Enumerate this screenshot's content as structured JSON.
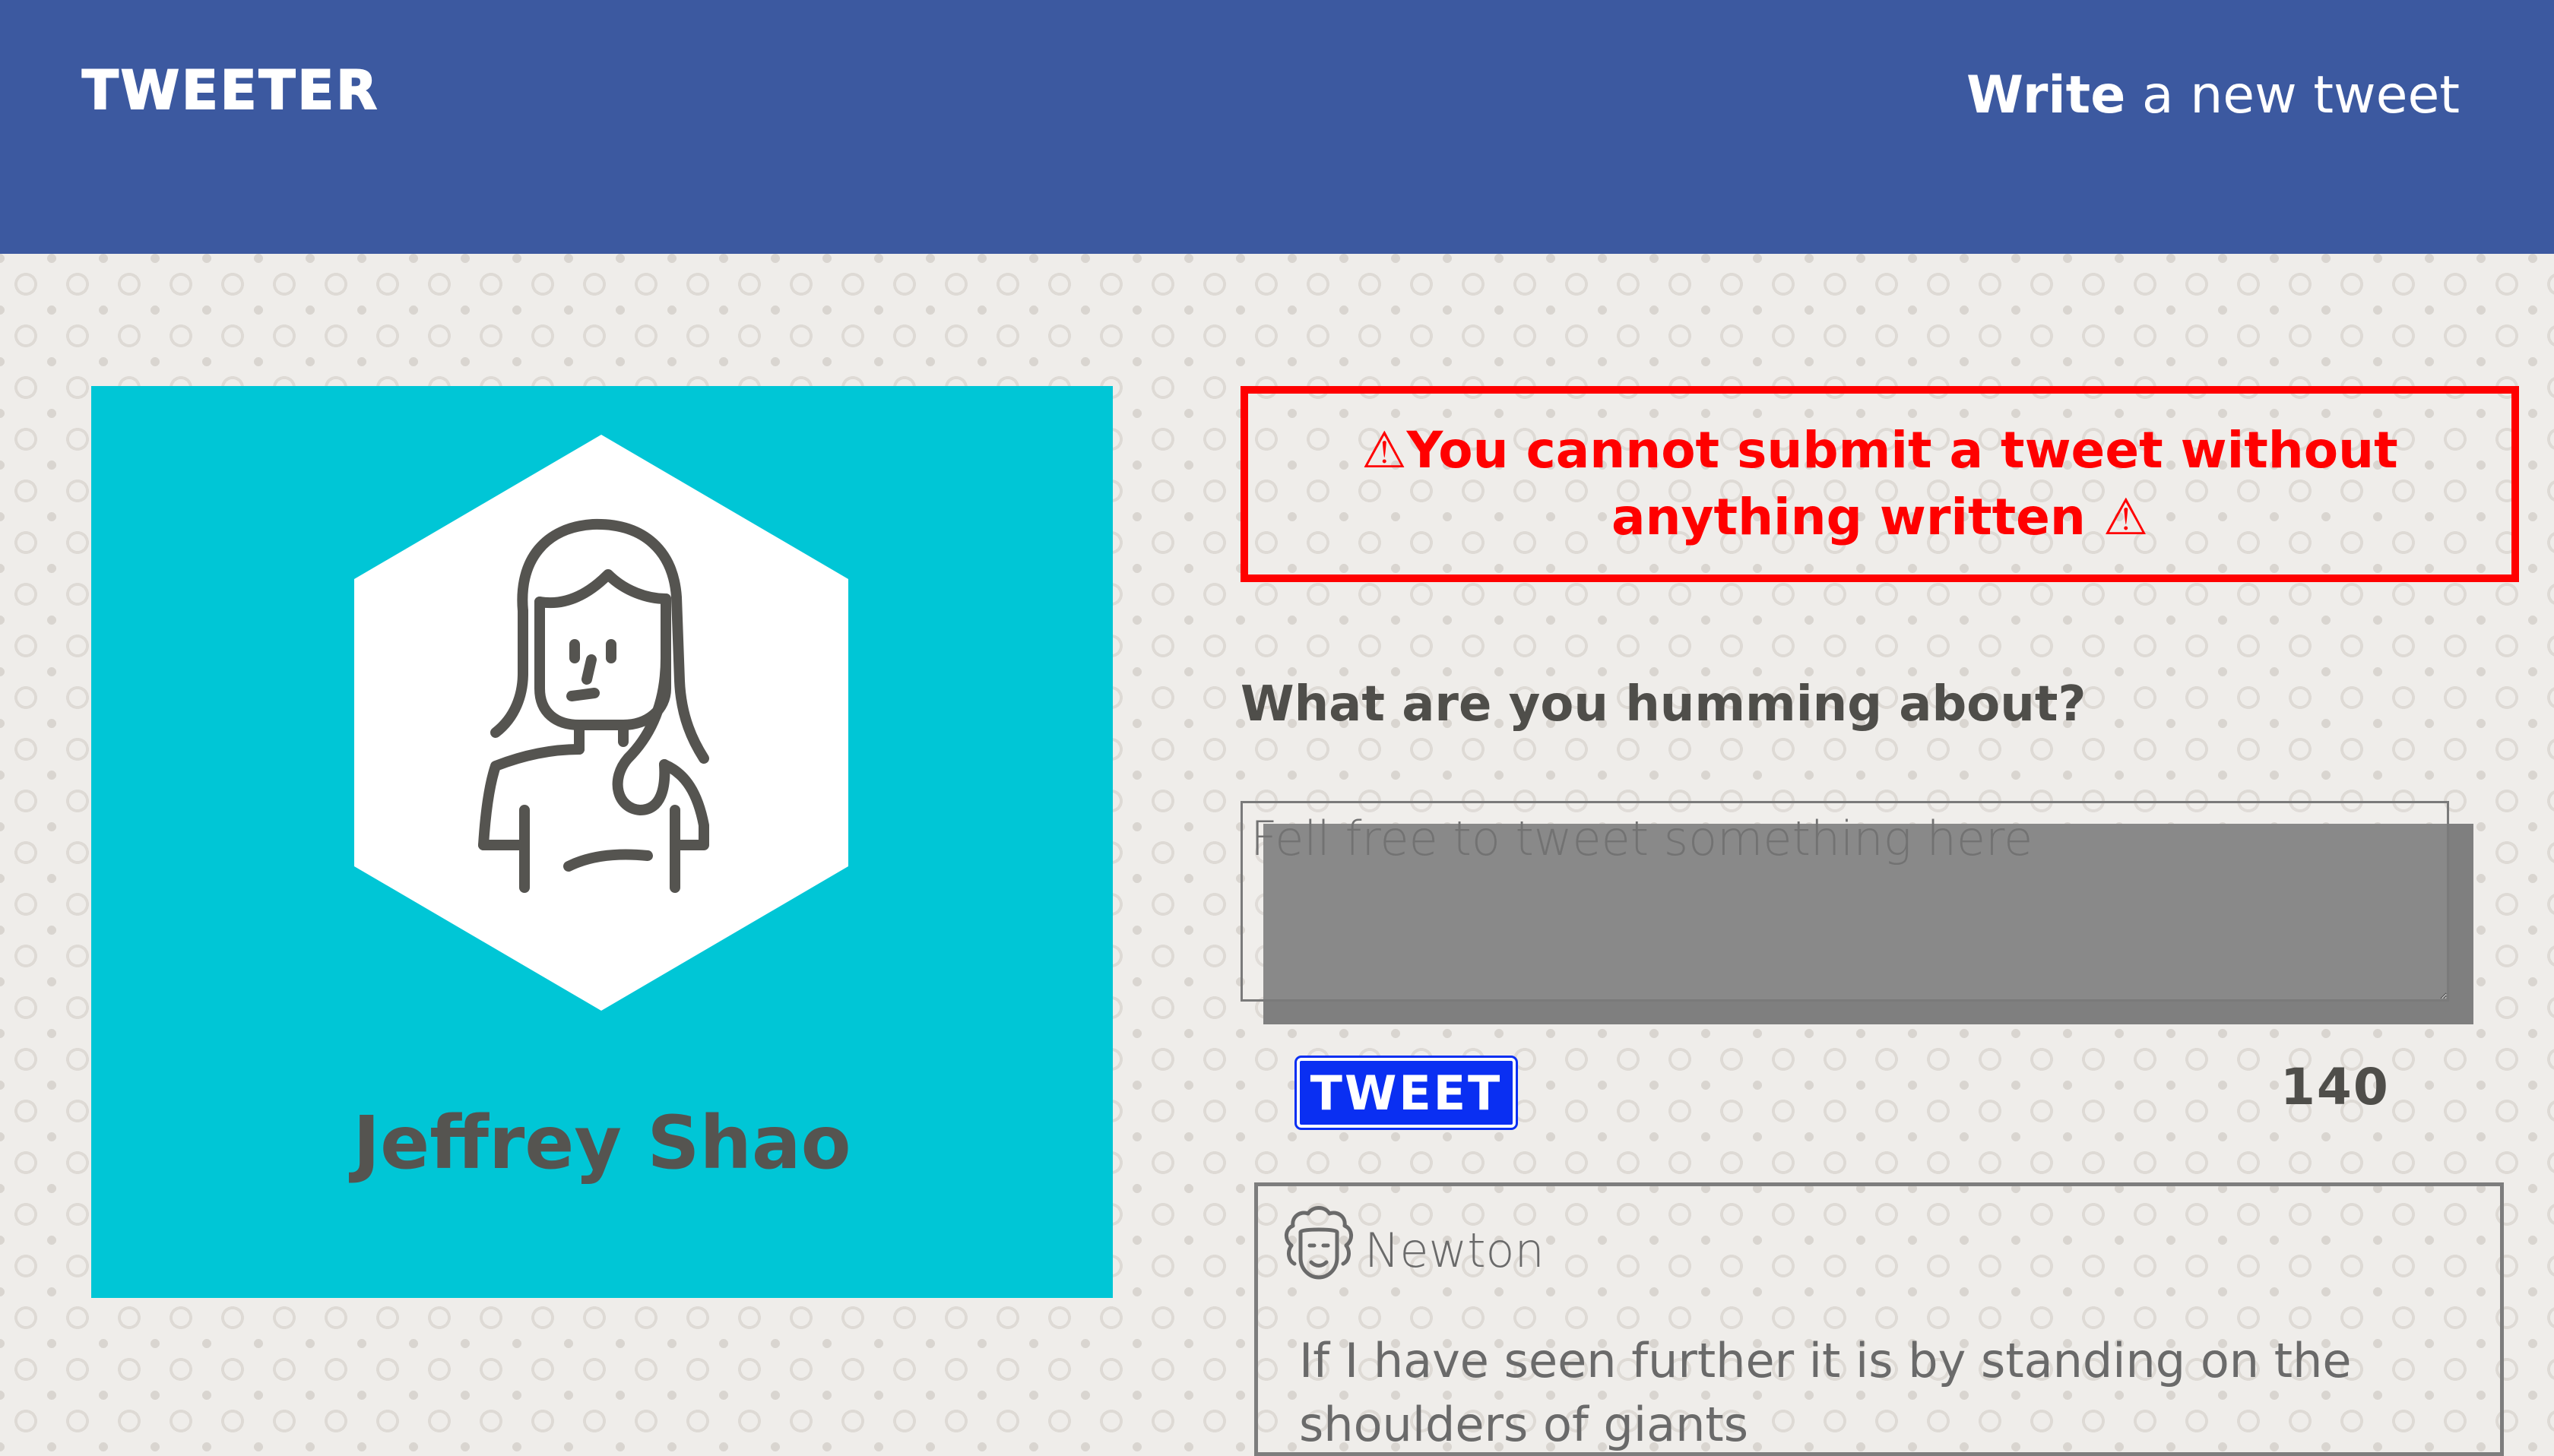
{
  "header": {
    "brand": "TWEETER",
    "write_bold": "Write",
    "write_rest": " a new tweet"
  },
  "profile": {
    "name": "Jeffrey Shao",
    "avatar_icon": "woman-avatar-icon"
  },
  "error": {
    "message": "⚠You cannot submit a tweet without anything written ⚠"
  },
  "compose": {
    "label": "What are you humming about?",
    "placeholder": "Fell free to tweet something here",
    "value": "",
    "button_label": "TWEET",
    "char_count": "140"
  },
  "feed": {
    "tweets": [
      {
        "author": "Newton",
        "avatar_icon": "newton-avatar-icon",
        "text": "If I have seen further it is by standing on the shoulders of giants"
      }
    ]
  },
  "colors": {
    "header_bg": "#3c59a0",
    "profile_bg": "#00c6d6",
    "error": "#ff0000",
    "button_bg": "#0a2ff2"
  }
}
